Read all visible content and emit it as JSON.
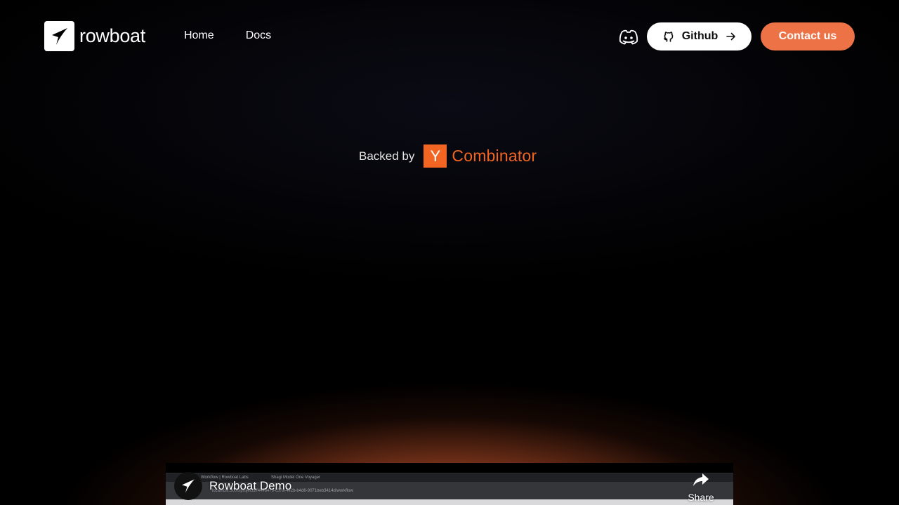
{
  "brand": {
    "name": "rowboat"
  },
  "nav": {
    "items": [
      {
        "label": "Home"
      },
      {
        "label": "Docs"
      }
    ]
  },
  "header": {
    "github_label": "Github",
    "contact_label": "Contact us"
  },
  "hero": {
    "backed_by": "Backed by",
    "yc_letter": "Y",
    "yc_name": "Combinator"
  },
  "video": {
    "title": "Rowboat Demo",
    "share_label": "Share",
    "browser_tab_1": "Workflow | Rowboat Labs",
    "browser_tab_2": "Shagi Model One Voyager",
    "browser_url": "localhost:3000/projects/f4448479-c37a-4e2b-b4d6-9071beb3414d/workflow"
  },
  "colors": {
    "accent": "#ed7347",
    "yc_orange": "#f26522",
    "background": "#000000"
  },
  "icons": {
    "logo": "rowboat-logo-icon",
    "discord": "discord-icon",
    "github": "github-icon",
    "arrow": "arrow-right-icon",
    "share": "share-icon"
  }
}
